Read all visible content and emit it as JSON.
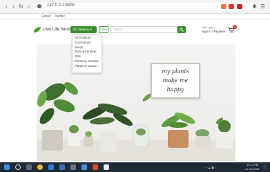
{
  "browser": {
    "url": "127.0.0.1:8000",
    "bookmarks": [
      "Gmail",
      "Netflix"
    ]
  },
  "header": {
    "brand": "Live Life Nursery",
    "categories_button": "All Category ▾",
    "view_button": "View",
    "search_placeholder": "Search",
    "account_small": "Hello, sign in",
    "account_main": "Sign in / Register",
    "cart_count": "0"
  },
  "dropdown": {
    "items": [
      "All Products",
      "Accessories",
      "Seeds",
      "Tools & Fertilizer",
      "Gifts",
      "Plants by occasion",
      "Plants by season"
    ]
  },
  "hero": {
    "sign_lines": [
      "my plants",
      "make me",
      "happy"
    ]
  },
  "taskbar": {
    "time": "10:13 PM",
    "date": "11-04-2023"
  },
  "colors": {
    "brand_green": "#3c8d2f",
    "taskbar": "#1f2a36",
    "badge_red": "#d62828"
  }
}
